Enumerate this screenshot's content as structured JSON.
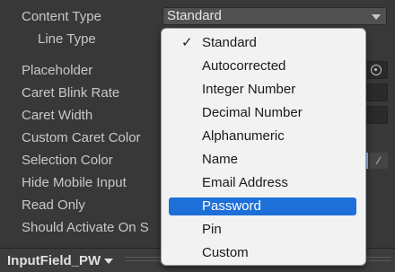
{
  "inspector": {
    "properties": [
      {
        "label": "Content Type"
      },
      {
        "label": "Line Type"
      },
      {
        "label": "Placeholder"
      },
      {
        "label": "Caret Blink Rate"
      },
      {
        "label": "Caret Width"
      },
      {
        "label": "Custom Caret Color"
      },
      {
        "label": "Selection Color"
      },
      {
        "label": "Hide Mobile Input"
      },
      {
        "label": "Read Only"
      },
      {
        "label": "Should Activate On S"
      }
    ],
    "content_type_value": "Standard"
  },
  "menu": {
    "items": [
      {
        "label": "Standard",
        "checked": true
      },
      {
        "label": "Autocorrected"
      },
      {
        "label": "Integer Number"
      },
      {
        "label": "Decimal Number"
      },
      {
        "label": "Alphanumeric"
      },
      {
        "label": "Name"
      },
      {
        "label": "Email Address"
      },
      {
        "label": "Password",
        "highlighted": true
      },
      {
        "label": "Pin"
      },
      {
        "label": "Custom"
      }
    ],
    "check_glyph": "✓"
  },
  "footer": {
    "object_name": "InputField_PW"
  },
  "colors": {
    "highlight": "#1e6fd8",
    "selection_swatch": "#8fb0e8",
    "panel_bg": "#383838"
  }
}
